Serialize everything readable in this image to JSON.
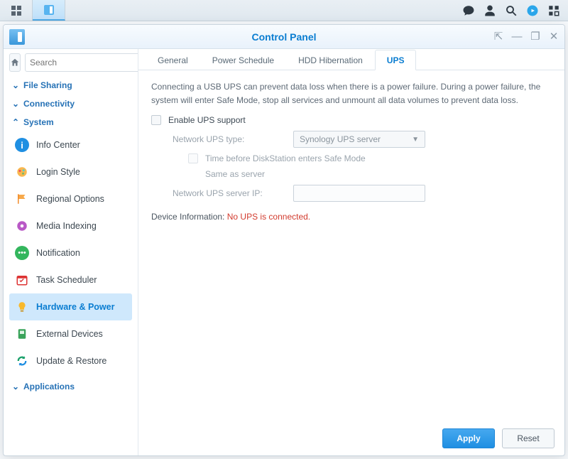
{
  "window": {
    "title": "Control Panel"
  },
  "search": {
    "placeholder": "Search"
  },
  "sections": {
    "file_sharing": "File Sharing",
    "connectivity": "Connectivity",
    "system": "System",
    "applications": "Applications"
  },
  "nav": {
    "info_center": "Info Center",
    "login_style": "Login Style",
    "regional": "Regional Options",
    "media_indexing": "Media Indexing",
    "notification": "Notification",
    "task_scheduler": "Task Scheduler",
    "hardware_power": "Hardware & Power",
    "external_devices": "External Devices",
    "update_restore": "Update & Restore"
  },
  "tabs": {
    "general": "General",
    "power_schedule": "Power Schedule",
    "hdd_hibernation": "HDD Hibernation",
    "ups": "UPS"
  },
  "ups": {
    "description": "Connecting a USB UPS can prevent data loss when there is a power failure. During a power failure, the system will enter Safe Mode, stop all services and unmount all data volumes to prevent data loss.",
    "enable_label": "Enable UPS support",
    "type_label": "Network UPS type:",
    "type_value": "Synology UPS server",
    "safe_mode_label": "Time before DiskStation enters Safe Mode",
    "same_as_server": "Same as server",
    "server_ip_label": "Network UPS server IP:",
    "server_ip_value": "",
    "device_info_label": "Device Information:",
    "device_info_value": "No UPS is connected."
  },
  "buttons": {
    "apply": "Apply",
    "reset": "Reset"
  }
}
